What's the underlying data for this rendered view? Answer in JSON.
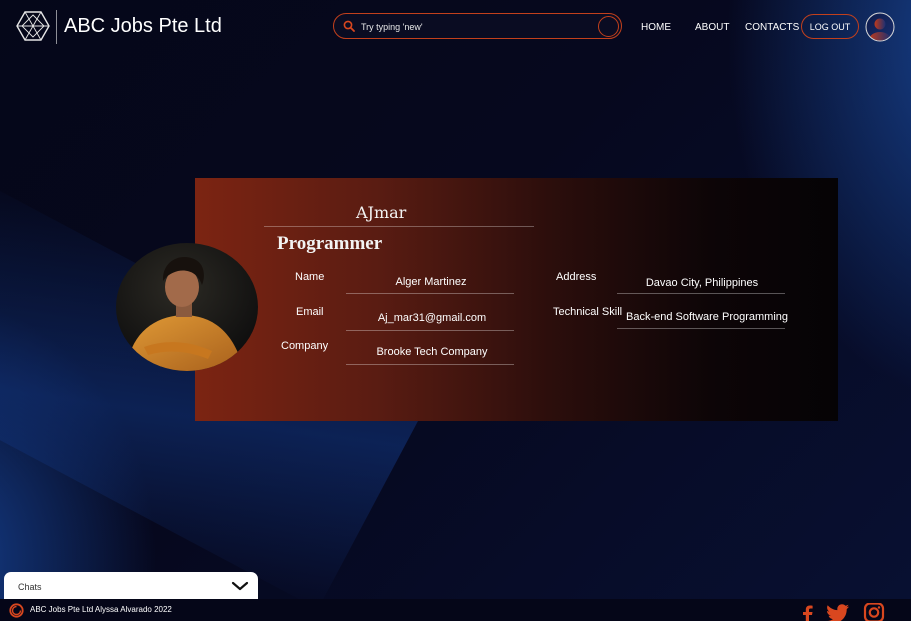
{
  "header": {
    "brand": "ABC Jobs Pte Ltd",
    "search_placeholder": "Try typing 'new'",
    "nav": {
      "home": "HOME",
      "about": "ABOUT",
      "contacts": "CONTACTS"
    },
    "logout_label": "LOG OUT"
  },
  "profile": {
    "username": "AJmar",
    "job_title": "Programmer",
    "fields": {
      "name_label": "Name",
      "name_value": "Alger Martinez",
      "email_label": "Email",
      "email_value": "Aj_mar31@gmail.com",
      "company_label": "Company",
      "company_value": "Brooke Tech Company",
      "address_label": "Address",
      "address_value": "Davao City, Philippines",
      "skill_label": "Technical Skill",
      "skill_value": "Back-end Software Programming"
    }
  },
  "chat": {
    "label": "Chats"
  },
  "footer": {
    "text": "ABC Jobs Pte Ltd Alyssa Alvarado 2022"
  },
  "colors": {
    "accent": "#c2401c",
    "background": "#060820",
    "card_start": "#7c2412",
    "card_end": "#050305"
  },
  "icons": [
    "logo-icon",
    "search-icon",
    "avatar-icon",
    "chevron-down-icon",
    "facebook-icon",
    "twitter-icon",
    "instagram-icon"
  ]
}
